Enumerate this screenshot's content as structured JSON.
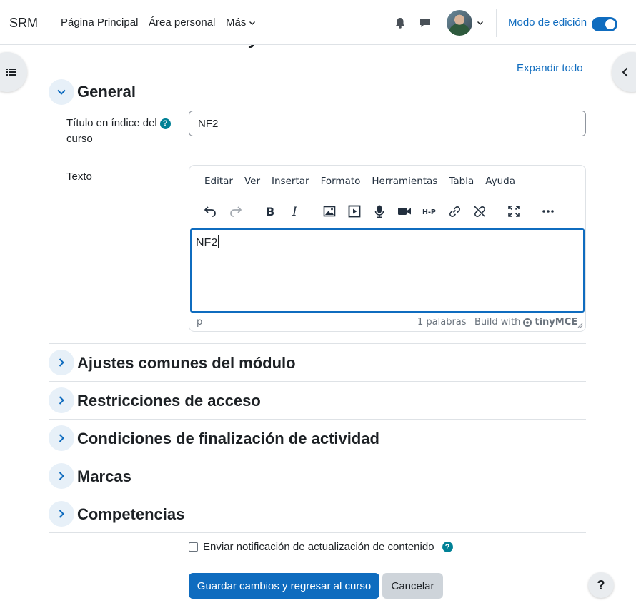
{
  "page": {
    "heading": "Nuevo Área de texto y medios"
  },
  "navbar": {
    "brand": "SRM",
    "links": {
      "home": "Página Principal",
      "personal": "Área personal",
      "more": "Más"
    },
    "edit_mode_label": "Modo de edición",
    "edit_mode_on": true
  },
  "form": {
    "expand_all": "Expandir todo",
    "general": {
      "title": "General",
      "title_label_line1": "Título en índice del",
      "title_label_line2": "curso",
      "title_value": "NF2",
      "text_label": "Texto"
    },
    "editor": {
      "menu": [
        "Editar",
        "Ver",
        "Insertar",
        "Formato",
        "Herramientas",
        "Tabla",
        "Ayuda"
      ],
      "content": "NF2",
      "status_path": "p",
      "word_count": "1 palabras",
      "build_with": "Build with",
      "tinymce": "tinyMCE"
    },
    "sections": [
      "Ajustes comunes del módulo",
      "Restricciones de acceso",
      "Condiciones de finalización de actividad",
      "Marcas",
      "Competencias"
    ],
    "notify_label": "Enviar notificación de actualización de contenido",
    "save_button": "Guardar cambios y regresar al curso",
    "cancel_button": "Cancelar"
  },
  "help_fab": "?",
  "colors": {
    "primary": "#0f6cbf",
    "help": "#008196",
    "text": "#1d2125"
  }
}
